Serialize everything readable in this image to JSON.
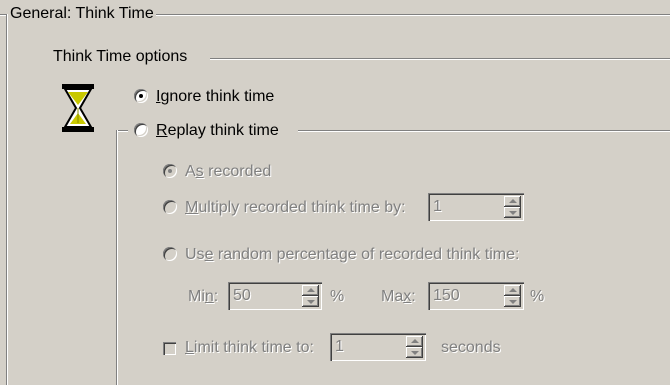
{
  "group_title": "General: Think Time",
  "section_title": "Think Time options",
  "icon": "hourglass-icon",
  "ignore_option": {
    "prefix": "",
    "accel": "I",
    "rest": "gnore think time",
    "selected": true
  },
  "replay_option": {
    "prefix": "",
    "accel": "R",
    "rest": "eplay think time",
    "selected": false
  },
  "as_recorded": {
    "prefix": "A",
    "accel": "s",
    "rest": " recorded",
    "selected": true
  },
  "multiply": {
    "prefix": "",
    "accel": "M",
    "rest": "ultiply recorded think time by:",
    "value": "1"
  },
  "random": {
    "prefix": "Us",
    "accel": "e",
    "rest": " random percentage of recorded think time:"
  },
  "min": {
    "prefix": "Mi",
    "accel": "n",
    "rest": ":",
    "value": "50",
    "unit": "%"
  },
  "max": {
    "prefix": "Ma",
    "accel": "x",
    "rest": ":",
    "value": "150",
    "unit": "%"
  },
  "limit": {
    "prefix": "",
    "accel": "L",
    "rest": "imit think time to:",
    "value": "1",
    "unit": "seconds",
    "checked": false
  }
}
